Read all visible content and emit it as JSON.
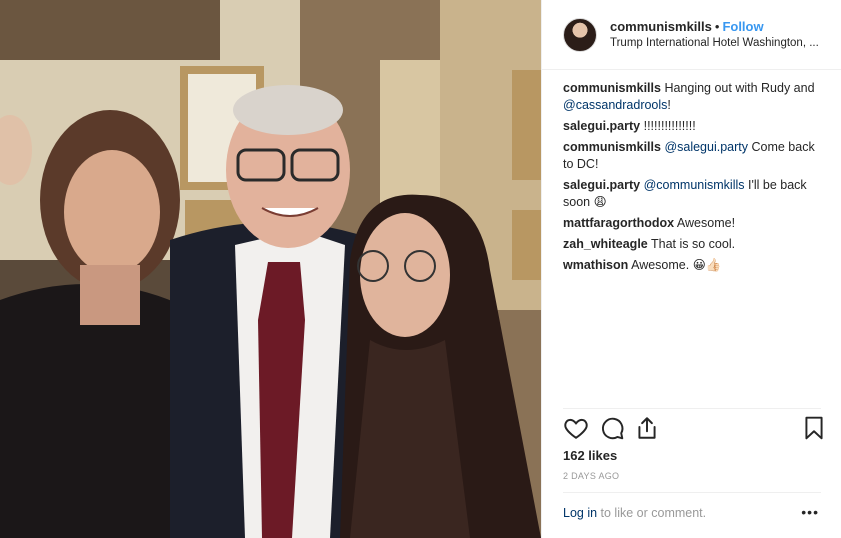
{
  "header": {
    "username": "communismkills",
    "separator": "•",
    "follow_label": "Follow",
    "location": "Trump International Hotel Washington, ..."
  },
  "comments": [
    {
      "user": "communismkills",
      "text_before": "Hanging out with Rudy and ",
      "mention": "@cassandradrools",
      "text_after": "!"
    },
    {
      "user": "salegui.party",
      "text_before": "!!!!!!!!!!!!!!!",
      "mention": "",
      "text_after": ""
    },
    {
      "user": "communismkills",
      "text_before": "",
      "mention": "@salegui.party",
      "text_after": " Come back to DC!"
    },
    {
      "user": "salegui.party",
      "text_before": "",
      "mention": "@communismkills",
      "text_after": " I'll be back soon 😩"
    },
    {
      "user": "mattfaragorthodox",
      "text_before": "Awesome!",
      "mention": "",
      "text_after": ""
    },
    {
      "user": "zah_whiteagle",
      "text_before": "That is so cool.",
      "mention": "",
      "text_after": ""
    },
    {
      "user": "wmathison",
      "text_before": "Awesome. 😀👍🏻",
      "mention": "",
      "text_after": ""
    }
  ],
  "likes": "162 likes",
  "timestamp": "2 DAYS AGO",
  "footer": {
    "login_label": "Log in",
    "login_suffix": " to like or comment.",
    "more_label": "•••"
  },
  "icons": {
    "like": "heart-icon",
    "comment": "comment-icon",
    "share": "share-icon",
    "save": "bookmark-icon"
  },
  "colors": {
    "link": "#3897f0",
    "mention": "#003569",
    "muted": "#999999"
  }
}
